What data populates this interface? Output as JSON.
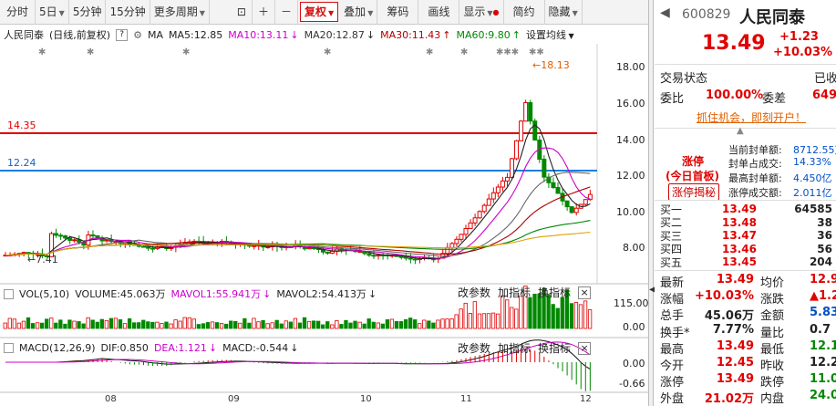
{
  "toolbar": {
    "items": [
      "分时",
      "5日",
      "5分钟",
      "15分钟",
      "更多周期"
    ],
    "adjust": "复权",
    "overlay": "叠加",
    "chips": "筹码",
    "draw": "画线",
    "display": "显示",
    "simple": "简约",
    "hide": "隐藏"
  },
  "chart_legend": {
    "name": "人民同泰",
    "mode": "(日线,前复权)",
    "q": "?",
    "ma": "MA",
    "ma5": "MA5:12.85",
    "ma10": "MA10:13.11",
    "ma20": "MA20:12.87",
    "ma30": "MA30:11.43",
    "ma60": "MA60:9.80",
    "settings": "设置均线"
  },
  "price_axis": [
    "18.00",
    "16.00",
    "14.00",
    "12.00",
    "10.00",
    "8.00"
  ],
  "levels": {
    "upper": "14.35",
    "lower": "12.24",
    "high_mark": "18.13",
    "low_mark": "7.41"
  },
  "volume": {
    "label": "VOL(5,10)",
    "vol": "VOLUME:45.063万",
    "mv1": "MAVOL1:55.941万",
    "mv2": "MAVOL2:54.413万",
    "axis": [
      "115.00",
      "0.00"
    ]
  },
  "macd": {
    "label": "MACD(12,26,9)",
    "dif": "DIF:0.850",
    "dea": "DEA:1.121",
    "macd": "MACD:-0.544",
    "axis": [
      "0.00",
      "-0.66"
    ]
  },
  "pane_buttons": {
    "param": "改参数",
    "add": "加指标",
    "swap": "换指标",
    "close": "×"
  },
  "x_labels": [
    "08",
    "09",
    "10",
    "11",
    "12"
  ],
  "quote": {
    "code": "600829",
    "name": "人民同泰",
    "price": "13.49",
    "change": "+1.23",
    "pct": "+10.03%",
    "trade_status_label": "交易状态",
    "trade_status": "已收",
    "wb_label": "委比",
    "wb": "100.00%",
    "wc_label": "委差",
    "wc": "649",
    "promo": "抓住机会，即刻开户！",
    "zt_label": "涨停",
    "first_board": "(今日首板)",
    "zt_reveal": "涨停揭秘",
    "seal_amount_label": "当前封单额:",
    "seal_amount": "8712.55万",
    "seal_ratio_label": "封单占成交:",
    "seal_ratio": "14.33%",
    "max_seal_label": "最高封单额:",
    "max_seal": "4.450亿",
    "zt_turnover_label": "涨停成交额:",
    "zt_turnover": "2.011亿",
    "bids": [
      {
        "label": "买一",
        "price": "13.49",
        "vol": "64585"
      },
      {
        "label": "买二",
        "price": "13.48",
        "vol": "38"
      },
      {
        "label": "买三",
        "price": "13.47",
        "vol": "36"
      },
      {
        "label": "买四",
        "price": "13.46",
        "vol": "56"
      },
      {
        "label": "买五",
        "price": "13.45",
        "vol": "204"
      }
    ],
    "stats": [
      {
        "l1": "最新",
        "v1": "13.49",
        "c1": "red",
        "l2": "均价",
        "v2": "12.9",
        "c2": "red"
      },
      {
        "l1": "涨幅",
        "v1": "+10.03%",
        "c1": "red",
        "l2": "涨跌",
        "v2": "▲1.2",
        "c2": "red"
      },
      {
        "l1": "总手",
        "v1": "45.06万",
        "c1": "dk",
        "l2": "金额",
        "v2": "5.83",
        "c2": "blu"
      },
      {
        "l1": "换手*",
        "v1": "7.77%",
        "c1": "dk",
        "l2": "量比",
        "v2": "0.7",
        "c2": "dk"
      },
      {
        "l1": "最高",
        "v1": "13.49",
        "c1": "red",
        "l2": "最低",
        "v2": "12.1",
        "c2": "grn"
      },
      {
        "l1": "今开",
        "v1": "12.45",
        "c1": "red",
        "l2": "昨收",
        "v2": "12.2",
        "c2": "dk"
      },
      {
        "l1": "涨停",
        "v1": "13.49",
        "c1": "red",
        "l2": "跌停",
        "v2": "11.0",
        "c2": "grn"
      },
      {
        "l1": "外盘",
        "v1": "21.02万",
        "c1": "red",
        "l2": "内盘",
        "v2": "24.04",
        "c2": "grn"
      }
    ]
  }
}
